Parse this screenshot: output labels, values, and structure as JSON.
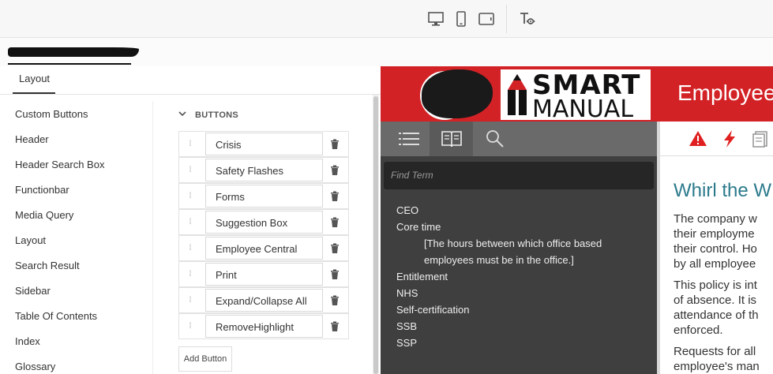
{
  "toolbar": {
    "devices": [
      "desktop-icon",
      "mobile-icon",
      "tablet-icon"
    ],
    "extra_tool": "text-preview-icon"
  },
  "document": {
    "name": ""
  },
  "tabs": {
    "active": "Layout"
  },
  "nav": {
    "items": [
      "Custom Buttons",
      "Header",
      "Header Search Box",
      "Functionbar",
      "Media Query",
      "Layout",
      "Search Result",
      "Sidebar",
      "Table Of Contents",
      "Index",
      "Glossary"
    ]
  },
  "buttons_section": {
    "title": "BUTTONS",
    "items": [
      "Crisis",
      "Safety Flashes",
      "Forms",
      "Suggestion Box",
      "Employee Central",
      "Print",
      "Expand/Collapse All",
      "RemoveHighlight"
    ],
    "add_label": "Add Button"
  },
  "preview": {
    "brand_colors": {
      "header": "#d32226",
      "sidebar": "#3f3f3f",
      "heading": "#2b7a8c"
    },
    "logo_line1": "SMART",
    "logo_line2": "MANUAL",
    "header_title": "Employee",
    "search_placeholder": "Find Term",
    "terms": [
      {
        "term": "CEO"
      },
      {
        "term": "Core time",
        "def": [
          "[The hours between which office based",
          "employees must be in the office.]"
        ]
      },
      {
        "term": "Entitlement"
      },
      {
        "term": "NHS"
      },
      {
        "term": "Self-certification"
      },
      {
        "term": "SSB"
      },
      {
        "term": "SSP"
      }
    ],
    "content_heading": "Whirl the W",
    "content_paragraphs": [
      [
        "The company w",
        "their employme",
        "their control. Ho",
        "by all employee"
      ],
      [
        "This policy is int",
        "of absence. It is",
        "attendance of th",
        "enforced."
      ],
      [
        "Requests for all",
        "employee's man"
      ]
    ]
  }
}
